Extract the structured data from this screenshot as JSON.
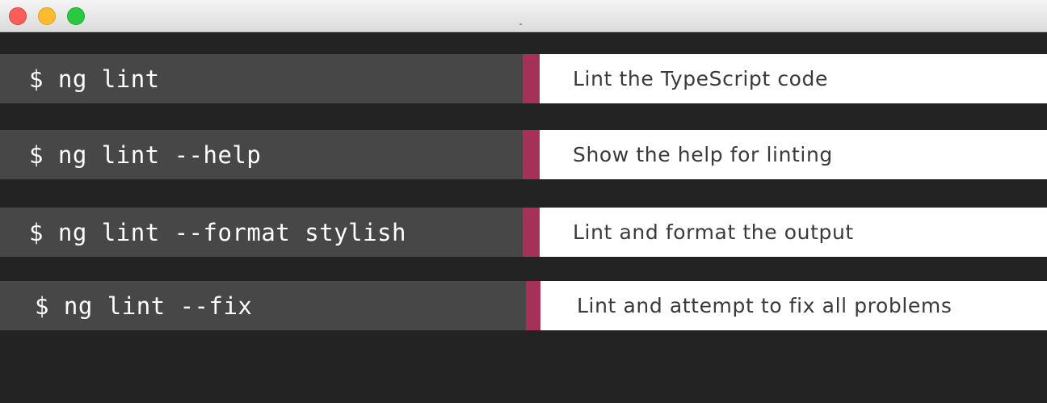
{
  "window": {
    "controls": {
      "close_color": "#fc5f57",
      "minimize_color": "#fdbc2e",
      "zoom_color": "#28c840"
    }
  },
  "theme": {
    "accent": "#a53159",
    "command_bg": "#474747",
    "terminal_bg": "#232323"
  },
  "rows": [
    {
      "command": "$ ng lint",
      "description": "Lint the TypeScript code"
    },
    {
      "command": "$ ng lint --help",
      "description": "Show the help for linting"
    },
    {
      "command": "$ ng lint --format stylish",
      "description": "Lint and format the output"
    },
    {
      "command": "$ ng lint --fix",
      "description": "Lint and attempt to fix all problems"
    }
  ]
}
